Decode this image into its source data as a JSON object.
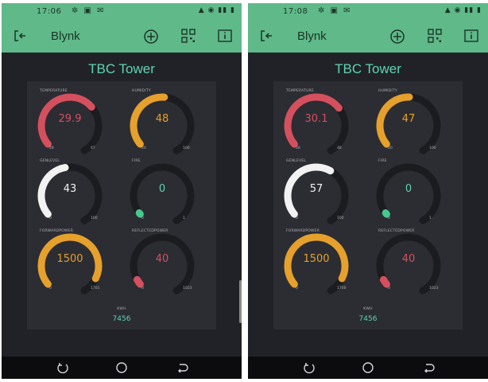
{
  "status_bar": [
    {
      "time": "17:06"
    },
    {
      "time": "17:08"
    }
  ],
  "app": {
    "title": "Blynk"
  },
  "dashboard": {
    "title": "TBC Tower"
  },
  "colors": {
    "header": "#5fb989",
    "background": "#212227",
    "panel": "#2b2d33",
    "track": "#1b1c20",
    "red": "#d4505e",
    "orange": "#e6a02c",
    "white": "#f2f2f2",
    "green": "#46c98a",
    "teal": "#5fd3b3"
  },
  "screens": [
    {
      "gauges": [
        {
          "label": "TEMPERATURE",
          "value": "29.9",
          "fraction": 0.64,
          "min": "28",
          "max": "47",
          "color": "#d4505e"
        },
        {
          "label": "HUMIDITY",
          "value": "48",
          "fraction": 0.48,
          "min": "20",
          "max": "100",
          "color": "#e6a02c"
        },
        {
          "label": "GENLEVEL",
          "value": "43",
          "fraction": 0.43,
          "min": "0",
          "max": "100",
          "color": "#f2f2f2"
        },
        {
          "label": "FIRE",
          "value": "0",
          "fraction": 0.0,
          "min": "0",
          "max": "1",
          "color": "#46c98a"
        },
        {
          "label": "FORWARDPOWER",
          "value": "1500",
          "fraction": 0.88,
          "min": "0",
          "max": "1701",
          "color": "#e6a02c"
        },
        {
          "label": "REFLECTEDPOWER",
          "value": "40",
          "fraction": 0.04,
          "min": "0",
          "max": "1023",
          "color": "#d4505e"
        }
      ],
      "kwh": {
        "label": "KWH",
        "value": "7456"
      }
    },
    {
      "gauges": [
        {
          "label": "TEMPERATURE",
          "value": "30.1",
          "fraction": 0.65,
          "min": "28",
          "max": "48",
          "color": "#d4505e"
        },
        {
          "label": "HUMIDITY",
          "value": "47",
          "fraction": 0.47,
          "min": "20",
          "max": "100",
          "color": "#e6a02c"
        },
        {
          "label": "GENLEVEL",
          "value": "57",
          "fraction": 0.57,
          "min": "0",
          "max": "100",
          "color": "#f2f2f2"
        },
        {
          "label": "FIRE",
          "value": "0",
          "fraction": 0.0,
          "min": "0",
          "max": "1",
          "color": "#46c98a"
        },
        {
          "label": "FORWARDPOWER",
          "value": "1500",
          "fraction": 0.88,
          "min": "0",
          "max": "1700",
          "color": "#e6a02c"
        },
        {
          "label": "REFLECTEDPOWER",
          "value": "40",
          "fraction": 0.04,
          "min": "0",
          "max": "1023",
          "color": "#d4505e"
        }
      ],
      "kwh": {
        "label": "KWH",
        "value": "7456"
      }
    }
  ],
  "pager": {
    "count": 3,
    "active": [
      1,
      1
    ]
  }
}
